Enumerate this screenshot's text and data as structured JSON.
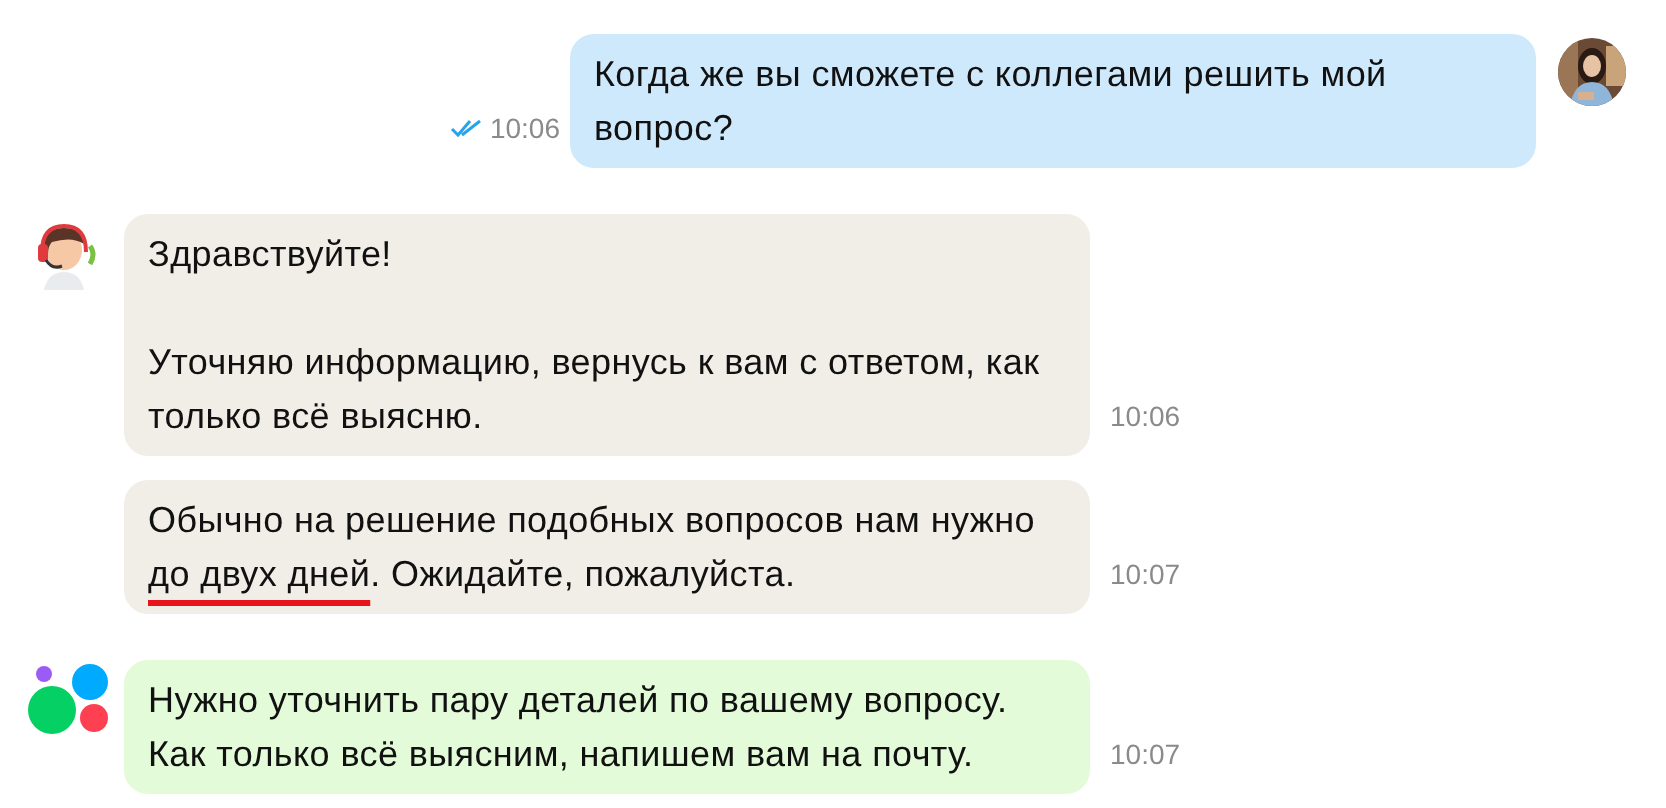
{
  "messages": [
    {
      "kind": "user",
      "avatar": {
        "kind": "picture"
      },
      "time": "10:06",
      "read": true,
      "paragraphs": [
        [
          {
            "text": "Когда же вы сможете с коллегами решить мой вопрос?"
          }
        ]
      ]
    },
    {
      "kind": "agent",
      "avatar": {
        "kind": "operator"
      },
      "time": "10:06",
      "paragraphs": [
        [
          {
            "text": "Здравствуйте!"
          }
        ],
        [
          {
            "text": "Уточняю информацию, вернусь к вам с ответом, как только всё выясню."
          }
        ]
      ]
    },
    {
      "kind": "agent",
      "time": "10:07",
      "paragraphs": [
        [
          {
            "text": "Обычно на решение подобных вопросов нам нужно "
          },
          {
            "text": "до двух дней",
            "underlined": true
          },
          {
            "text": ". Ожидайте, пожалуйста."
          }
        ]
      ]
    },
    {
      "kind": "bot",
      "avatar": {
        "kind": "logo"
      },
      "time": "10:07",
      "paragraphs": [
        [
          {
            "text": "Нужно уточнить пару деталей по вашему вопросу. Как только всё выясним, напишем вам на почту."
          }
        ]
      ]
    }
  ]
}
